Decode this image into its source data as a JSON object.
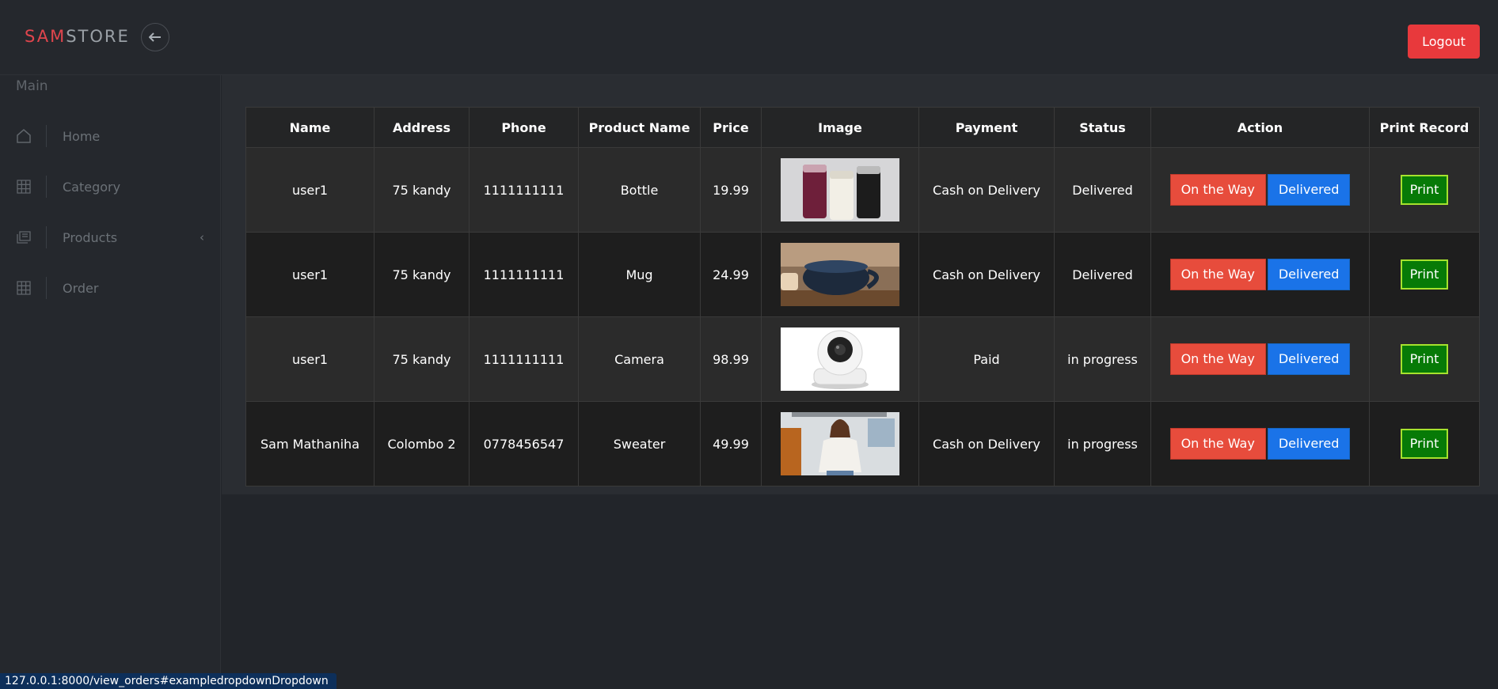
{
  "header": {
    "brand_a": "SAM",
    "brand_b": "STORE",
    "logout_label": "Logout"
  },
  "sidebar": {
    "heading": "Main",
    "items": [
      {
        "label": "Home",
        "icon": "home-icon"
      },
      {
        "label": "Category",
        "icon": "grid-icon"
      },
      {
        "label": "Products",
        "icon": "layers-icon"
      },
      {
        "label": "Order",
        "icon": "grid-icon"
      }
    ]
  },
  "table": {
    "headers": [
      "Name",
      "Address",
      "Phone",
      "Product Name",
      "Price",
      "Image",
      "Payment",
      "Status",
      "Action",
      "Print Record"
    ],
    "rows": [
      {
        "name": "user1",
        "address": "75 kandy",
        "phone": "1111111111",
        "product": "Bottle",
        "price": "19.99",
        "image": "bottle",
        "payment": "Cash on Delivery",
        "status": "Delivered"
      },
      {
        "name": "user1",
        "address": "75 kandy",
        "phone": "1111111111",
        "product": "Mug",
        "price": "24.99",
        "image": "mug",
        "payment": "Cash on Delivery",
        "status": "Delivered"
      },
      {
        "name": "user1",
        "address": "75 kandy",
        "phone": "1111111111",
        "product": "Camera",
        "price": "98.99",
        "image": "camera",
        "payment": "Paid",
        "status": "in progress"
      },
      {
        "name": "Sam Mathaniha",
        "address": "Colombo 2",
        "phone": "0778456547",
        "product": "Sweater",
        "price": "49.99",
        "image": "sweater",
        "payment": "Cash on Delivery",
        "status": "in progress"
      }
    ],
    "btn_way": "On the Way",
    "btn_delivered": "Delivered",
    "btn_print": "Print"
  },
  "statusbar": {
    "url": "127.0.0.1:8000/view_orders#exampledropdownDropdown"
  },
  "colors": {
    "brand_red": "#e0454d",
    "logout": "#e8393c",
    "on_the_way": "#e74c3c",
    "delivered_btn": "#1a73e8",
    "print_btn": "#077a07",
    "status_delivered": "#1f8a1f",
    "status_progress": "#ff1a1a",
    "payment_cod": "#1414d8"
  }
}
